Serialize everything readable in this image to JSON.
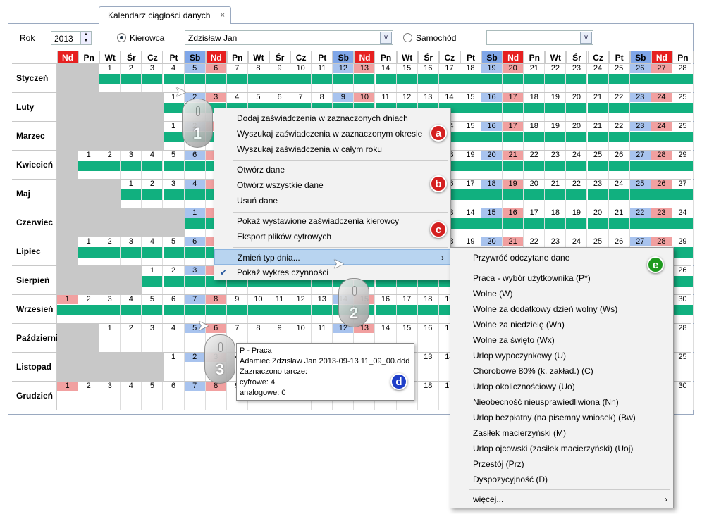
{
  "tab": {
    "title": "Kalendarz ciągłości danych",
    "close": "×"
  },
  "toolbar": {
    "rok_label": "Rok",
    "rok_value": "2013",
    "kierowca_label": "Kierowca",
    "kierowca_value": "Zdzisław Jan",
    "samochod_label": "Samochód",
    "samochod_value": "",
    "dropdown_glyph": "∨"
  },
  "weekday_header": [
    "Nd",
    "Pn",
    "Wt",
    "Śr",
    "Cz",
    "Pt",
    "Sb",
    "Nd",
    "Pn",
    "Wt",
    "Śr",
    "Cz",
    "Pt",
    "Sb",
    "Nd",
    "Pn",
    "Wt",
    "Śr",
    "Cz",
    "Pt",
    "Sb",
    "Nd",
    "Pn",
    "Wt",
    "Śr",
    "Cz",
    "Pt",
    "Sb",
    "Nd",
    "Pn"
  ],
  "months": [
    {
      "name": "Styczeń",
      "first_col": 2,
      "days": 31
    },
    {
      "name": "Luty",
      "first_col": 5,
      "days": 28
    },
    {
      "name": "Marzec",
      "first_col": 5,
      "days": 31
    },
    {
      "name": "Kwiecień",
      "first_col": 1,
      "days": 30
    },
    {
      "name": "Maj",
      "first_col": 3,
      "days": 31
    },
    {
      "name": "Czerwiec",
      "first_col": 6,
      "days": 30
    },
    {
      "name": "Lipiec",
      "first_col": 1,
      "days": 31
    },
    {
      "name": "Sierpień",
      "first_col": 4,
      "days": 31
    },
    {
      "name": "Wrzesień",
      "first_col": 0,
      "days": 30
    },
    {
      "name": "Październik",
      "first_col": 2,
      "days": 31
    },
    {
      "name": "Listopad",
      "first_col": 5,
      "days": 30
    },
    {
      "name": "Grudzień",
      "first_col": 0,
      "days": 31
    }
  ],
  "context_menu": {
    "items": [
      "Dodaj zaświadczenia w zaznaczonych dniach",
      "Wyszukaj zaświadczenia w zaznaczonym okresie",
      "Wyszukaj zaświadczenia w całym roku",
      "Otwórz dane",
      "Otwórz wszystkie dane",
      "Usuń dane",
      "Pokaż wystawione zaświadczenia kierowcy",
      "Eksport plików cyfrowych",
      "Zmień typ dnia...",
      "Pokaż wykres czynności"
    ],
    "submenu_arrow": "›",
    "check": "✔"
  },
  "submenu": {
    "items": [
      "Przywróć odczytane dane",
      "Praca - wybór użytkownika (P*)",
      "Wolne (W)",
      "Wolne za dodatkowy dzień wolny (Ws)",
      "Wolne za niedzielę (Wn)",
      "Wolne za święto (Wx)",
      "Urlop wypoczynkowy (U)",
      "Chorobowe 80% (k. zakład.) (C)",
      "Urlop okolicznościowy (Uo)",
      "Nieobecność nieusprawiedliwiona (Nn)",
      "Urlop bezpłatny (na pisemny wniosek) (Bw)",
      "Zasiłek macierzyński (M)",
      "Urlop ojcowski (zasiłek macierzyński) (Uoj)",
      "Przestój (Prz)",
      "Dyspozycyjność (D)",
      "więcej..."
    ]
  },
  "tooltip": {
    "line1": "P - Praca",
    "line2": "Adamiec Zdzisław Jan 2013-09-13 11_09_00.ddd",
    "line3": "Zaznaczono tarcze:",
    "line4": "cyfrowe: 4",
    "line5": "analogowe: 0"
  },
  "badges": {
    "a": "a",
    "b": "b",
    "c": "c",
    "d": "d",
    "e": "e"
  },
  "badge_colors": {
    "red": "#d42020",
    "blue": "#1f3fc8",
    "green": "#1e9a1e"
  },
  "mice": [
    "1",
    "2",
    "3"
  ],
  "colors": {
    "work_bar": "#11b07f",
    "sunday": "#e62020",
    "saturday": "#7fa6e8",
    "sunday_light": "#f1a0a0",
    "saturday_light": "#a8c3ee"
  }
}
